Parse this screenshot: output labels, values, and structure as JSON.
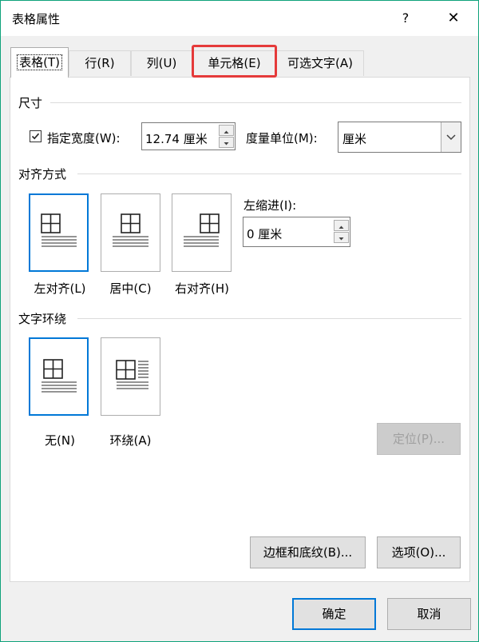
{
  "window": {
    "title": "表格属性",
    "help": "?",
    "close": "✕"
  },
  "tabs": [
    {
      "label": "表格(T)"
    },
    {
      "label": "行(R)"
    },
    {
      "label": "列(U)"
    },
    {
      "label": "单元格(E)"
    },
    {
      "label": "可选文字(A)"
    }
  ],
  "active_tab": 0,
  "highlighted_tab": 3,
  "highlight_color": "#e53a3a",
  "accent_color": "#0078d7",
  "size": {
    "heading": "尺寸",
    "specify_width_label": "指定宽度(W):",
    "specify_width_checked": true,
    "width_value": "12.74 厘米",
    "unit_label": "度量单位(M):",
    "unit_value": "厘米"
  },
  "alignment": {
    "heading": "对齐方式",
    "options": [
      {
        "label": "左对齐(L)"
      },
      {
        "label": "居中(C)"
      },
      {
        "label": "右对齐(H)"
      }
    ],
    "selected": 0,
    "indent_label": "左缩进(I):",
    "indent_value": "0 厘米"
  },
  "wrapping": {
    "heading": "文字环绕",
    "options": [
      {
        "label": "无(N)"
      },
      {
        "label": "环绕(A)"
      }
    ],
    "selected": 0,
    "position_button": "定位(P)..."
  },
  "buttons": {
    "borders": "边框和底纹(B)...",
    "options": "选项(O)...",
    "ok": "确定",
    "cancel": "取消"
  }
}
